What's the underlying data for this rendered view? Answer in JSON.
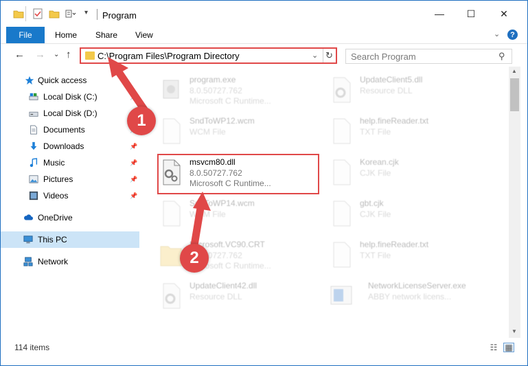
{
  "window": {
    "title": "Program",
    "buttons": {
      "minimize": "—",
      "maximize": "☐",
      "close": "✕"
    }
  },
  "ribbon": {
    "file": "File",
    "tabs": [
      "Home",
      "Share",
      "View"
    ],
    "chevron": "⌄",
    "help": "?"
  },
  "nav": {
    "back": "←",
    "forward": "→",
    "recent": "⌄",
    "up": "↑",
    "address": "C:\\Program Files\\Program Directory",
    "address_dropdown": "⌄",
    "refresh": "↻",
    "search_placeholder": "Search Program",
    "search_icon": "⚲"
  },
  "sidebar": {
    "items": [
      {
        "label": "Quick access",
        "icon": "star-icon",
        "pinned": false
      },
      {
        "label": "Local Disk (C:)",
        "icon": "drive-icon",
        "pinned": true
      },
      {
        "label": "Local Disk (D:)",
        "icon": "drive-icon",
        "pinned": true
      },
      {
        "label": "Documents",
        "icon": "document-icon",
        "pinned": true
      },
      {
        "label": "Downloads",
        "icon": "download-icon",
        "pinned": true
      },
      {
        "label": "Music",
        "icon": "music-icon",
        "pinned": true
      },
      {
        "label": "Pictures",
        "icon": "picture-icon",
        "pinned": true
      },
      {
        "label": "Videos",
        "icon": "video-icon",
        "pinned": true
      },
      {
        "label": "OneDrive",
        "icon": "cloud-icon",
        "pinned": false
      },
      {
        "label": "This PC",
        "icon": "computer-icon",
        "pinned": false
      },
      {
        "label": "Network",
        "icon": "network-icon",
        "pinned": false
      }
    ],
    "pin_glyph": "📌"
  },
  "files": [
    {
      "name": "program.exe",
      "line1": "8.0.50727.762",
      "line2": "Microsoft C Runtime...",
      "icon": "exe-icon",
      "faded": true
    },
    {
      "name": "UpdateClient5.dll",
      "line1": "Resource DLL",
      "line2": "",
      "icon": "dll-icon",
      "faded": true
    },
    {
      "name": "SndToWP12.wcm",
      "line1": "WCM File",
      "line2": "",
      "icon": "generic-file-icon",
      "faded": true
    },
    {
      "name": "help.fineReader.txt",
      "line1": "TXT File",
      "line2": "",
      "icon": "generic-file-icon",
      "faded": true
    },
    {
      "name": "msvcm80.dll",
      "line1": "8.0.50727.762",
      "line2": "Microsoft C Runtime...",
      "icon": "dll-icon",
      "faded": false
    },
    {
      "name": "Korean.cjk",
      "line1": "CJK File",
      "line2": "",
      "icon": "generic-file-icon",
      "faded": true
    },
    {
      "name": "SndToWP14.wcm",
      "line1": "WCM File",
      "line2": "",
      "icon": "generic-file-icon",
      "faded": true
    },
    {
      "name": "gbt.cjk",
      "line1": "CJK File",
      "line2": "",
      "icon": "generic-file-icon",
      "faded": true
    },
    {
      "name": "Microsoft.VC90.CRT",
      "line1": "8.0.50727.762",
      "line2": "Microsoft C Runtime...",
      "icon": "folder-icon",
      "faded": true
    },
    {
      "name": "help.fineReader.txt",
      "line1": "TXT File",
      "line2": "",
      "icon": "generic-file-icon",
      "faded": true
    },
    {
      "name": "UpdateClient42.dll",
      "line1": "Resource DLL",
      "line2": "",
      "icon": "dll-icon",
      "faded": true
    },
    {
      "name": "NetworkLicenseServer.exe",
      "line1": "ABBY network licens...",
      "line2": "",
      "icon": "app-exe-icon",
      "faded": true
    }
  ],
  "annotations": {
    "step1": "1",
    "step2": "2"
  },
  "status": {
    "items": "114 items"
  },
  "colors": {
    "accent": "#1979ca",
    "highlight": "#e04848",
    "folder": "#f3c94a",
    "selected": "#cce4f7"
  }
}
